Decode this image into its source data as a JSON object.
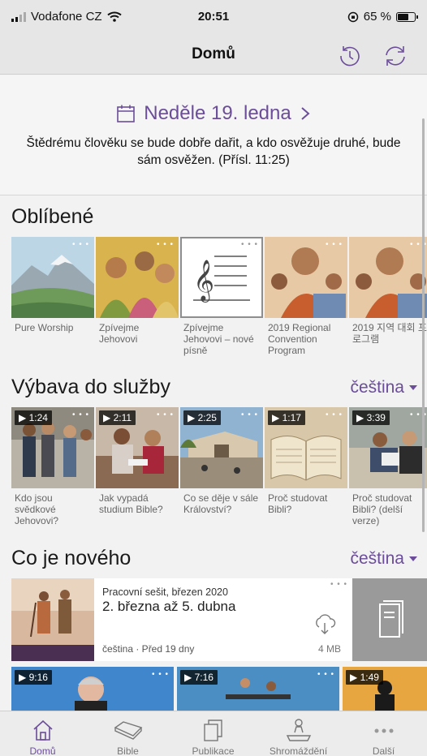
{
  "status_bar": {
    "carrier": "Vodafone CZ",
    "time": "20:51",
    "battery": "65 %"
  },
  "nav": {
    "title": "Domů"
  },
  "daily_text": {
    "date": "Neděle 19. ledna",
    "text": "Štědrému člověku se bude dobře dařit, a kdo osvěžuje druhé, bude sám osvěžen. (Přísl. 11:25)"
  },
  "favorites": {
    "title": "Oblíbené",
    "items": [
      {
        "label": "Pure Worship"
      },
      {
        "label": "Zpívejme Jehovovi"
      },
      {
        "label": "Zpívejme Jehovovi – nové písně"
      },
      {
        "label": "2019 Regional Convention Program"
      },
      {
        "label": "2019 지역 대회 프로그램"
      }
    ]
  },
  "ministry": {
    "title": "Výbava do služby",
    "language": "čeština",
    "items": [
      {
        "label": "Kdo jsou svědkové Jehovovi?",
        "duration": "1:24"
      },
      {
        "label": "Jak vypadá studium Bible?",
        "duration": "2:11"
      },
      {
        "label": "Co se děje v sále Království?",
        "duration": "2:25"
      },
      {
        "label": "Proč studovat Bibli?",
        "duration": "1:17"
      },
      {
        "label": "Proč studovat Bibli? (delší verze)",
        "duration": "3:39"
      }
    ]
  },
  "whats_new": {
    "title": "Co je nového",
    "language": "čeština",
    "item": {
      "kicker": "Pracovní sešit, březen 2020",
      "headline": "2. března až 5. dubna",
      "meta": "čeština · Před 19 dny",
      "size": "4 MB"
    },
    "videos": [
      {
        "duration": "9:16"
      },
      {
        "duration": "7:16"
      },
      {
        "duration": "1:49"
      }
    ]
  },
  "tabs": [
    {
      "label": "Domů",
      "icon": "home-icon"
    },
    {
      "label": "Bible",
      "icon": "bible-icon"
    },
    {
      "label": "Publikace",
      "icon": "publications-icon"
    },
    {
      "label": "Shromáždění",
      "icon": "meetings-icon"
    },
    {
      "label": "Další",
      "icon": "more-icon"
    }
  ],
  "colors": {
    "accent": "#6b4d9a"
  }
}
